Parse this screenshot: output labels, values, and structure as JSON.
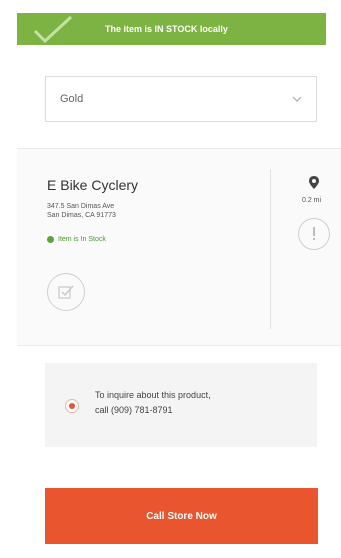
{
  "banner": {
    "text": "The item is IN STOCK locally",
    "color": "#7cb342"
  },
  "color_select": {
    "value": "Gold"
  },
  "store": {
    "name": "E Bike Cyclery",
    "address_line1": "347.5 San Dimas Ave",
    "address_line2": "San Dimas, CA 91773",
    "stock_text": "Item is In Stock",
    "distance": "0.2 mi"
  },
  "inquire": {
    "line1": "To inquire about this product,",
    "line2": "call (909) 781-8791"
  },
  "call_button": {
    "label": "Call Store Now",
    "color": "#e8552e"
  }
}
